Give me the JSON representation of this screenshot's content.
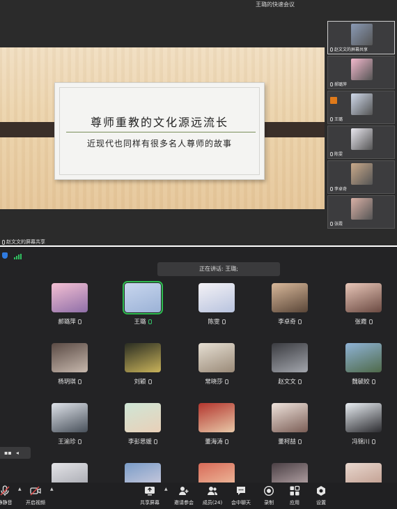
{
  "window_title": "王璐的快速会议",
  "slide": {
    "headline": "尊师重教的文化源远流长",
    "subtitle": "近现代也同样有很多名人尊师的故事"
  },
  "share_label": "赵文文的屏幕共享",
  "thumbnails": [
    {
      "name": "赵文文的屏幕共享",
      "icon": "screen-share-icon",
      "color": "#8a9ab5"
    },
    {
      "name": "郝璐萍",
      "icon": "mic-icon",
      "color": "#f2b8cc"
    },
    {
      "name": "王璐",
      "icon": "mic-icon",
      "color": "#cfd9ea"
    },
    {
      "name": "陈雯",
      "icon": "mic-icon",
      "color": "#e9e7ef"
    },
    {
      "name": "李卓奇",
      "icon": "mic-icon",
      "color": "#c9a98a"
    },
    {
      "name": "张霞",
      "icon": "mic-icon",
      "color": "#d9b0a5"
    }
  ],
  "speaking_banner": "正在讲话: 王璐;",
  "participants": [
    {
      "name": "郝璐萍",
      "color1": "#f4c0d3",
      "color2": "#8f6fa8"
    },
    {
      "name": "王璐",
      "color1": "#c8d6ee",
      "color2": "#9bb2d6",
      "speaker": true
    },
    {
      "name": "陈雯",
      "color1": "#f4f2f6",
      "color2": "#b8c3de"
    },
    {
      "name": "李卓奇",
      "color1": "#d8b89a",
      "color2": "#5a4638"
    },
    {
      "name": "张霞",
      "color1": "#e8c6b8",
      "color2": "#6b4a42"
    },
    {
      "name": "杨玥琪",
      "color1": "#5a4a44",
      "color2": "#c7b8ad"
    },
    {
      "name": "刘颖",
      "color1": "#2a2d22",
      "color2": "#c9b35a"
    },
    {
      "name": "常晓莎",
      "color1": "#e6dfd3",
      "color2": "#9a8a78"
    },
    {
      "name": "赵文文",
      "color1": "#3a3b40",
      "color2": "#a3a6ad"
    },
    {
      "name": "魏毓姣",
      "color1": "#8fb3d6",
      "color2": "#4f6a4a"
    },
    {
      "name": "王渝珍",
      "color1": "#dfe3ea",
      "color2": "#48505a"
    },
    {
      "name": "李彭思媛",
      "color1": "#cfe6d6",
      "color2": "#e9d0b8"
    },
    {
      "name": "董海涛",
      "color1": "#b3362e",
      "color2": "#e8c8a8"
    },
    {
      "name": "董柯喆",
      "color1": "#efe3dc",
      "color2": "#7b5e56"
    },
    {
      "name": "冯锦川",
      "color1": "#e9eef3",
      "color2": "#2c2c30"
    },
    {
      "name": "",
      "color1": "#e4e4e8",
      "color2": "#9ea0a8"
    },
    {
      "name": "",
      "color1": "#7a9cc8",
      "color2": "#d8d2e0"
    },
    {
      "name": "",
      "color1": "#d86a58",
      "color2": "#f1c9a8"
    },
    {
      "name": "",
      "color1": "#4a3f44",
      "color2": "#c8b6b8"
    },
    {
      "name": "",
      "color1": "#e9d8cf",
      "color2": "#b99384"
    }
  ],
  "toolbar": {
    "mute": "静静音",
    "video": "开启视频",
    "share": "共享屏幕",
    "invite": "邀请参会",
    "members": "成员(24)",
    "chat": "会中聊天",
    "record": "录制",
    "apps": "应用",
    "settings": "设置"
  }
}
